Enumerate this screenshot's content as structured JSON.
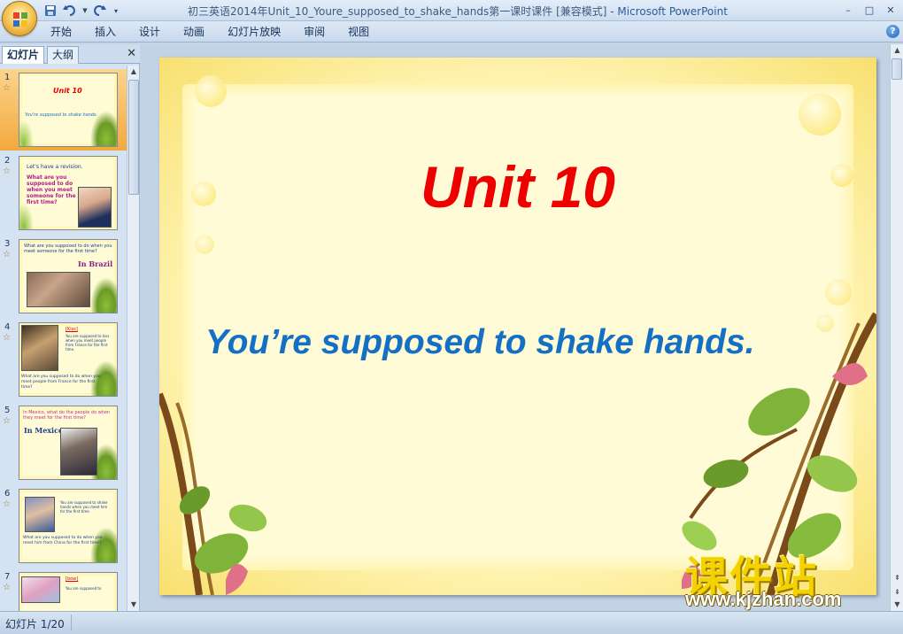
{
  "window": {
    "title": "初三英语2014年Unit_10_Youre_supposed_to_shake_hands第一课时课件 [兼容模式]",
    "title_separator": " - ",
    "app_name": "Microsoft PowerPoint",
    "minimize": "–",
    "maximize": "□",
    "close": "✕"
  },
  "menu": {
    "tabs": [
      "开始",
      "插入",
      "设计",
      "动画",
      "幻灯片放映",
      "审阅",
      "视图"
    ],
    "help": "?"
  },
  "left_pane": {
    "tabs": [
      "幻灯片",
      "大纲"
    ],
    "close": "✕",
    "thumbnails": [
      {
        "num": "1",
        "title": "Unit 10",
        "text": "You're supposed to shake hands."
      },
      {
        "num": "2",
        "line1": "Let's have a revision.",
        "line2": "What are you supposed to do when you meet someone for the first time?"
      },
      {
        "num": "3",
        "line1": "What are you supposed to do when you meet someone for the first time?",
        "caption": "In Brazil"
      },
      {
        "num": "4",
        "tag": "[Kiss]",
        "text": "You are supposed to kiss when you meet people from France for the first time.",
        "question": "What are you supposed to do when you meet people from France for the first time?"
      },
      {
        "num": "5",
        "line1": "In Mexico, what do the people do when they meet for the first time?",
        "caption": "In Mexico"
      },
      {
        "num": "6",
        "text": "You are supposed to shake hands when you meet him for the first time.",
        "question": "What are you supposed to do when you meet him from China for the first time?"
      },
      {
        "num": "7",
        "tag": "[bow]",
        "text": "You are supposed to"
      }
    ]
  },
  "slide": {
    "title": "Unit 10",
    "subtitle": "You’re supposed to shake hands."
  },
  "watermark": {
    "chinese": "课件站",
    "url": "www.kjzhan.com"
  },
  "status": {
    "slide_indicator": "幻灯片 1/20"
  },
  "colors": {
    "title_red": "#ee0000",
    "subtitle_blue": "#1470c4",
    "selected_thumb": "#f3a93c"
  }
}
